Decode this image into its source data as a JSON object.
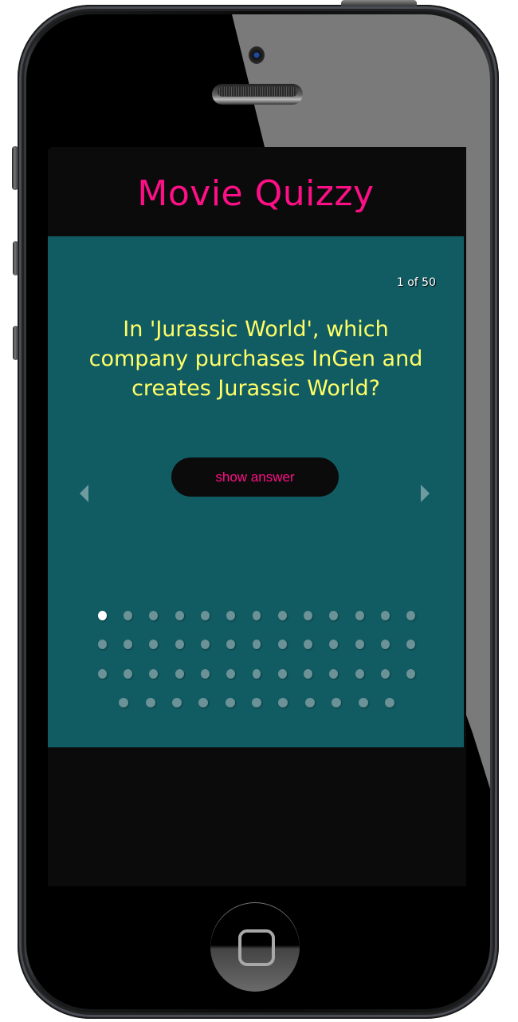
{
  "app": {
    "title": "Movie Quizzy",
    "accent_color": "#ff0f86",
    "card_color": "#115c63",
    "question_color": "#ffff66"
  },
  "quiz": {
    "counter": "1 of 50",
    "current_index": 1,
    "total": 50,
    "question": "In 'Jurassic World', which company purchases InGen and creates Jurassic World?",
    "show_answer_label": "show answer",
    "prev_icon": "triangle-left-icon",
    "next_icon": "triangle-right-icon"
  },
  "pager": {
    "rows": [
      13,
      13,
      13,
      11
    ],
    "active": 1
  },
  "device": {
    "home_button_icon": "rounded-square-icon"
  }
}
